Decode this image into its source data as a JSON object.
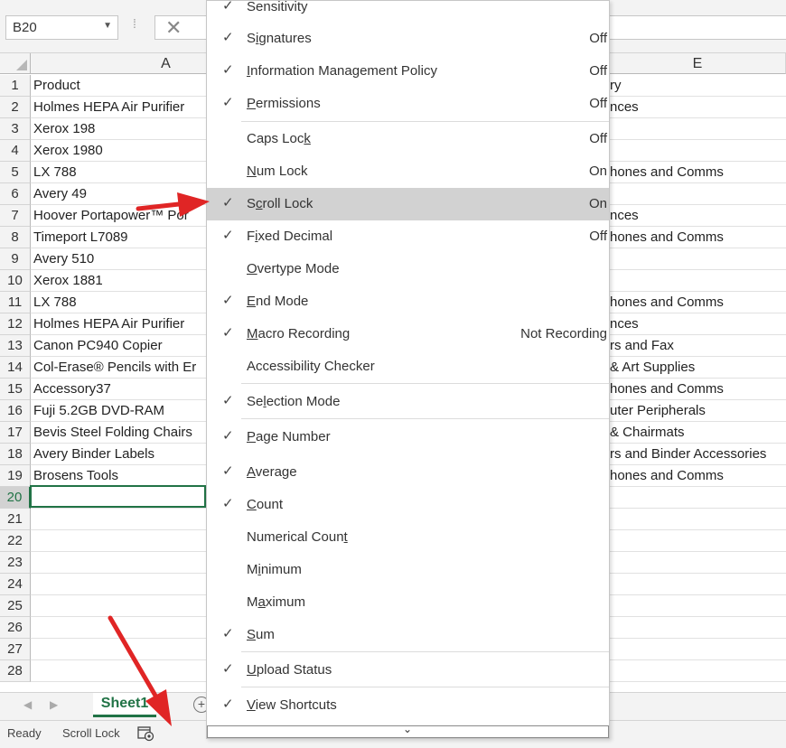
{
  "formula_bar": {
    "name_box": "B20",
    "cancel_symbol": "✕",
    "more_symbol": "⁞"
  },
  "columns": {
    "a": "A",
    "e": "E"
  },
  "rows": [
    {
      "num": "1",
      "a": "Product",
      "e": "ry"
    },
    {
      "num": "2",
      "a": "Holmes HEPA Air Purifier",
      "e": "nces"
    },
    {
      "num": "3",
      "a": "Xerox 198",
      "e": ""
    },
    {
      "num": "4",
      "a": "Xerox 1980",
      "e": ""
    },
    {
      "num": "5",
      "a": "LX 788",
      "e": "hones and Comms"
    },
    {
      "num": "6",
      "a": "Avery 49",
      "e": ""
    },
    {
      "num": "7",
      "a": "Hoover Portapower™ Por",
      "e": "nces"
    },
    {
      "num": "8",
      "a": "Timeport L7089",
      "e": "hones and Comms"
    },
    {
      "num": "9",
      "a": "Avery 510",
      "e": ""
    },
    {
      "num": "10",
      "a": "Xerox 1881",
      "e": ""
    },
    {
      "num": "11",
      "a": "LX 788",
      "e": "hones and Comms"
    },
    {
      "num": "12",
      "a": "Holmes HEPA Air Purifier",
      "e": "nces"
    },
    {
      "num": "13",
      "a": "Canon PC940 Copier",
      "e": "rs and Fax"
    },
    {
      "num": "14",
      "a": "Col-Erase® Pencils with Er",
      "e": "& Art Supplies"
    },
    {
      "num": "15",
      "a": "Accessory37",
      "e": "hones and Comms"
    },
    {
      "num": "16",
      "a": "Fuji 5.2GB DVD-RAM",
      "e": "uter Peripherals"
    },
    {
      "num": "17",
      "a": "Bevis Steel Folding Chairs",
      "e": "& Chairmats"
    },
    {
      "num": "18",
      "a": "Avery Binder Labels",
      "e": "rs and Binder Accessories"
    },
    {
      "num": "19",
      "a": "Brosens Tools",
      "e": "hones and Comms"
    },
    {
      "num": "20",
      "a": "",
      "e": ""
    },
    {
      "num": "21",
      "a": "",
      "e": ""
    },
    {
      "num": "22",
      "a": "",
      "e": ""
    },
    {
      "num": "23",
      "a": "",
      "e": ""
    },
    {
      "num": "24",
      "a": "",
      "e": ""
    },
    {
      "num": "25",
      "a": "",
      "e": ""
    },
    {
      "num": "26",
      "a": "",
      "e": ""
    },
    {
      "num": "27",
      "a": "",
      "e": ""
    },
    {
      "num": "28",
      "a": "",
      "e": ""
    }
  ],
  "sheet_tabs": {
    "active": "Sheet1",
    "add_symbol": "+"
  },
  "status_bar": {
    "ready": "Ready",
    "scroll_lock": "Scroll Lock"
  },
  "context_menu": {
    "items": [
      {
        "label": "Sensitivity",
        "checked": true,
        "value": ""
      },
      {
        "label": "Signatures",
        "checked": true,
        "value": "Off"
      },
      {
        "label": "Information Management Policy",
        "checked": true,
        "value": "Off"
      },
      {
        "label": "Permissions",
        "checked": true,
        "value": "Off"
      },
      {
        "label": "Caps Lock",
        "checked": false,
        "value": "Off"
      },
      {
        "label": "Num Lock",
        "checked": false,
        "value": "On"
      },
      {
        "label": "Scroll Lock",
        "checked": true,
        "value": "On",
        "highlighted": true
      },
      {
        "label": "Fixed Decimal",
        "checked": true,
        "value": "Off"
      },
      {
        "label": "Overtype Mode",
        "checked": false,
        "value": ""
      },
      {
        "label": "End Mode",
        "checked": true,
        "value": ""
      },
      {
        "label": "Macro Recording",
        "checked": true,
        "value": "Not Recording"
      },
      {
        "label": "Accessibility Checker",
        "checked": false,
        "value": ""
      },
      {
        "label": "Selection Mode",
        "checked": true,
        "value": ""
      },
      {
        "label": "Page Number",
        "checked": true,
        "value": ""
      },
      {
        "label": "Average",
        "checked": true,
        "value": ""
      },
      {
        "label": "Count",
        "checked": true,
        "value": ""
      },
      {
        "label": "Numerical Count",
        "checked": false,
        "value": ""
      },
      {
        "label": "Minimum",
        "checked": false,
        "value": ""
      },
      {
        "label": "Maximum",
        "checked": false,
        "value": ""
      },
      {
        "label": "Sum",
        "checked": true,
        "value": ""
      },
      {
        "label": "Upload Status",
        "checked": true,
        "value": ""
      },
      {
        "label": "View Shortcuts",
        "checked": true,
        "value": ""
      }
    ],
    "check_symbol": "✓",
    "more_symbol": "⌄"
  },
  "colors": {
    "accent": "#217346",
    "arrow": "#e02525",
    "highlight": "#d2d2d2"
  }
}
